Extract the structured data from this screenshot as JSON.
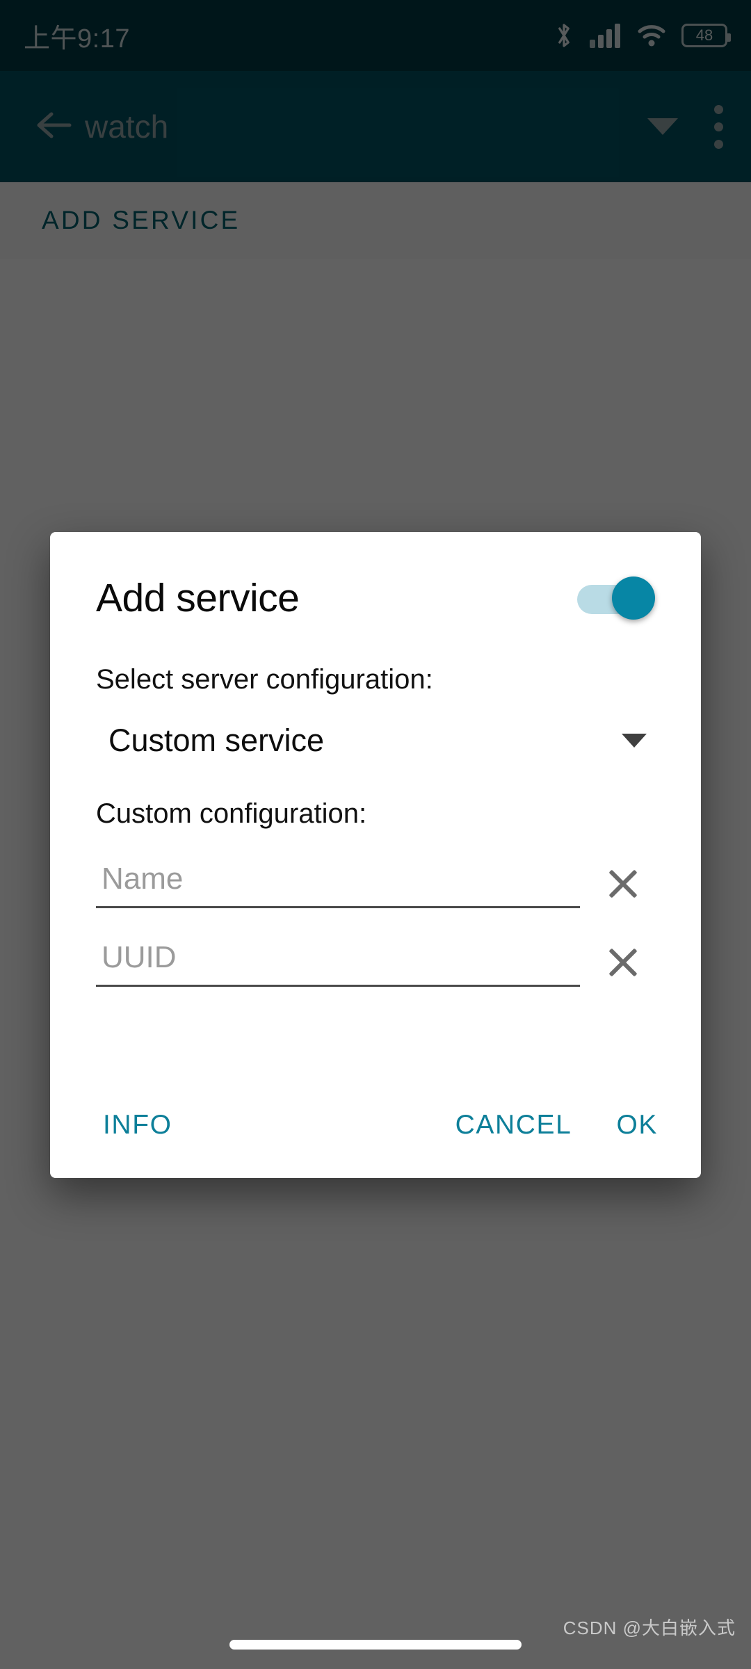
{
  "status_bar": {
    "time": "上午9:17",
    "battery_level": "48",
    "icons": [
      "bluetooth-icon",
      "cellular-signal-icon",
      "wifi-icon",
      "battery-icon"
    ]
  },
  "app_bar": {
    "back_label": "←",
    "title": "watch",
    "caret_icon": "chevron-down-icon",
    "overflow_icon": "more-vertical-icon"
  },
  "tab_bar": {
    "tabs": [
      {
        "label": "ADD SERVICE"
      }
    ]
  },
  "dialog": {
    "title": "Add service",
    "enabled_switch": {
      "state": "on",
      "track_color": "#b9dbe5",
      "thumb_color": "#0786a5"
    },
    "server_config": {
      "label": "Select server configuration:",
      "selected": "Custom service",
      "caret_icon": "triangle-down-icon"
    },
    "custom_config": {
      "label": "Custom configuration:",
      "fields": [
        {
          "name": "name",
          "value": "",
          "placeholder": "Name",
          "clear_icon": "close-icon"
        },
        {
          "name": "uuid",
          "value": "",
          "placeholder": "UUID",
          "clear_icon": "close-icon"
        }
      ]
    },
    "actions": {
      "info": "INFO",
      "cancel": "CANCEL",
      "ok": "OK"
    }
  },
  "watermark": "CSDN @大白嵌入式",
  "colors": {
    "status_bar_bg": "#003a45",
    "app_bar_bg": "#005363",
    "accent": "#0d7f99",
    "tab_text": "#00616f",
    "scrim": "rgba(0,0,0,0.62)"
  }
}
